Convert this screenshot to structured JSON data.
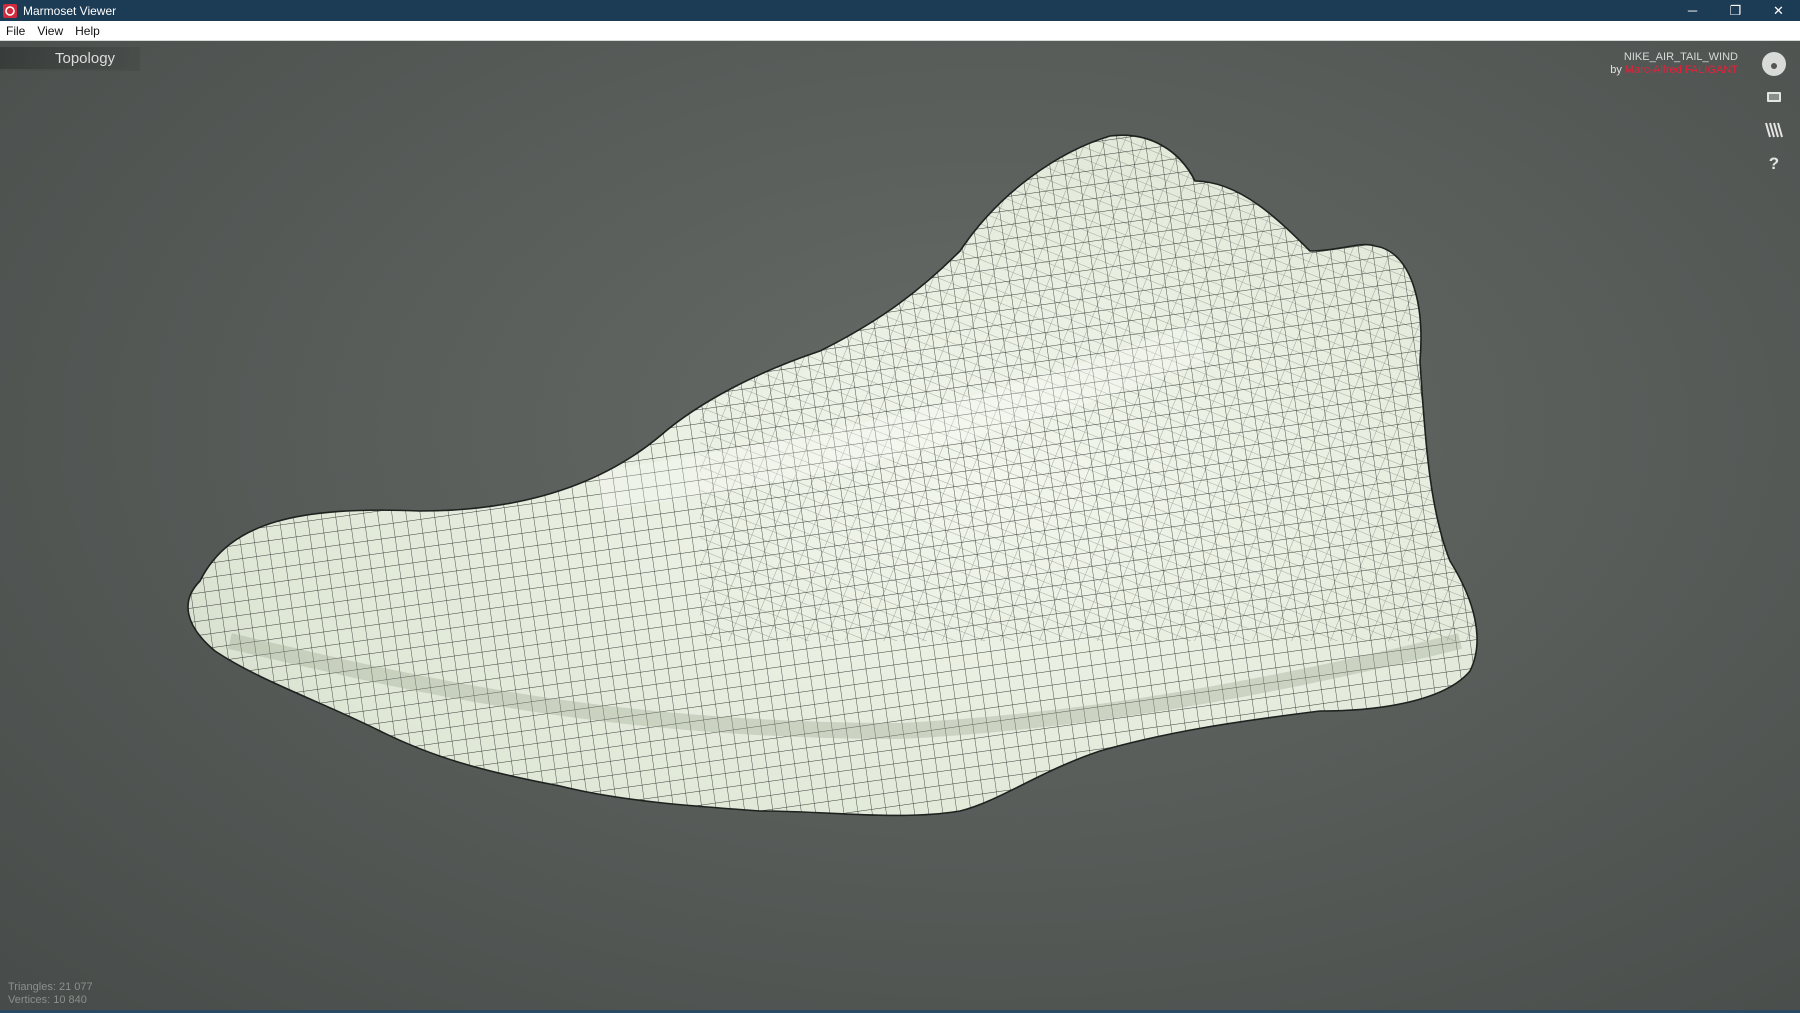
{
  "window": {
    "title": "Marmoset Viewer",
    "controls": {
      "minimize": "─",
      "restore": "❐",
      "close": "✕"
    }
  },
  "menu": {
    "items": [
      "File",
      "View",
      "Help"
    ]
  },
  "viewport": {
    "mode_label": "Topology",
    "model_name": "NIKE_AIR_TAIL_WIND",
    "by_prefix": "by",
    "author": "Marc-Alfred FALIGANT",
    "stats": {
      "triangles": "Triangles: 21 077",
      "vertices": "Vertices: 10 840"
    },
    "toolbar_icons": [
      "avatar-icon",
      "fullscreen-icon",
      "render-mode-icon",
      "help-icon"
    ]
  },
  "colors": {
    "titlebar": "#1c3b55",
    "author_accent": "#e2233a",
    "mesh_fill": "#e6ecdf",
    "wire": "#1e221f"
  }
}
